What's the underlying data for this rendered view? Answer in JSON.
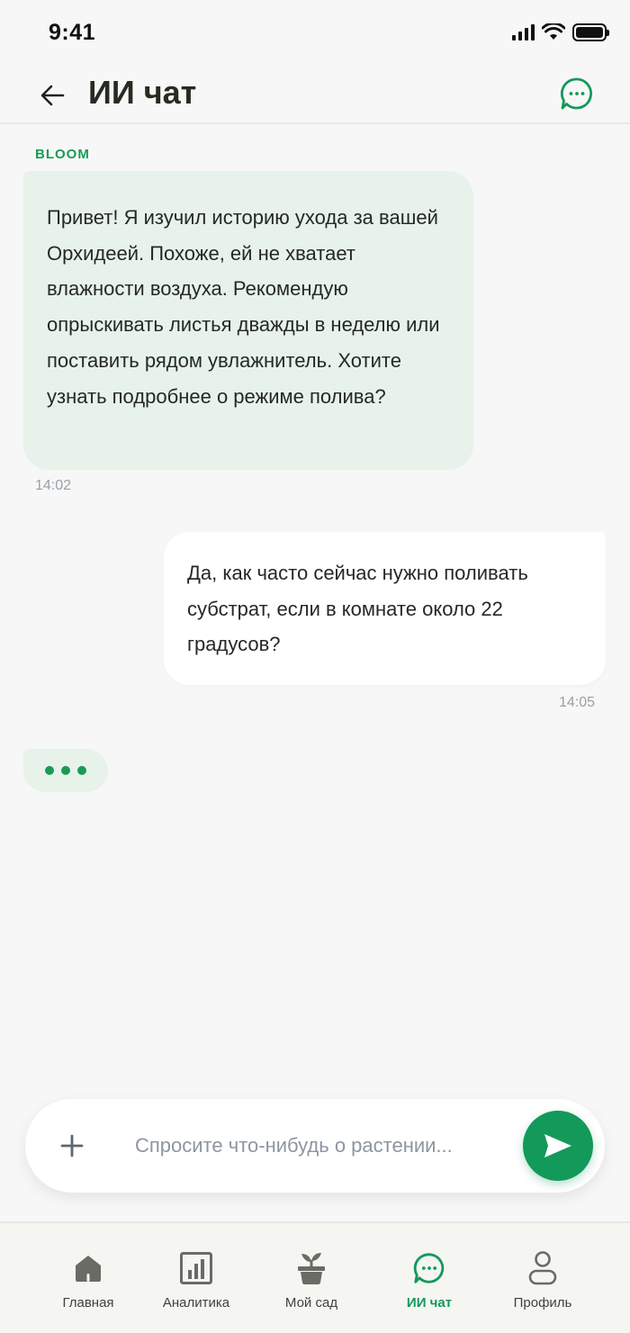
{
  "status_bar": {
    "time": "9:41"
  },
  "header": {
    "title": "ИИ чат"
  },
  "messages": [
    {
      "sender": "BLOOM",
      "text": "Привет! Я изучил историю ухода за вашей Орхидеей. Похоже, ей не хватает влажности воздуха. Рекомендую опрыскивать листья дважды в неделю или поставить рядом увлажнитель. Хотите узнать подробнее о режиме полива?",
      "time": "14:02"
    },
    {
      "text": "Да, как часто сейчас нужно поливать субстрат, если в комнате около 22 градусов?",
      "time": "14:05"
    }
  ],
  "composer": {
    "placeholder": "Спросите что-нибудь о растении..."
  },
  "nav": {
    "items": [
      {
        "label": "Главная",
        "icon": "home-icon"
      },
      {
        "label": "Аналитика",
        "icon": "analytics-icon"
      },
      {
        "label": "Мой сад",
        "icon": "plant-icon"
      },
      {
        "label": "ИИ чат",
        "icon": "chat-icon",
        "active": true
      },
      {
        "label": "Профиль",
        "icon": "profile-icon"
      }
    ]
  },
  "colors": {
    "accent": "#13995a",
    "bot_bubble": "#e7f3ea",
    "background": "#f7f7f7"
  }
}
